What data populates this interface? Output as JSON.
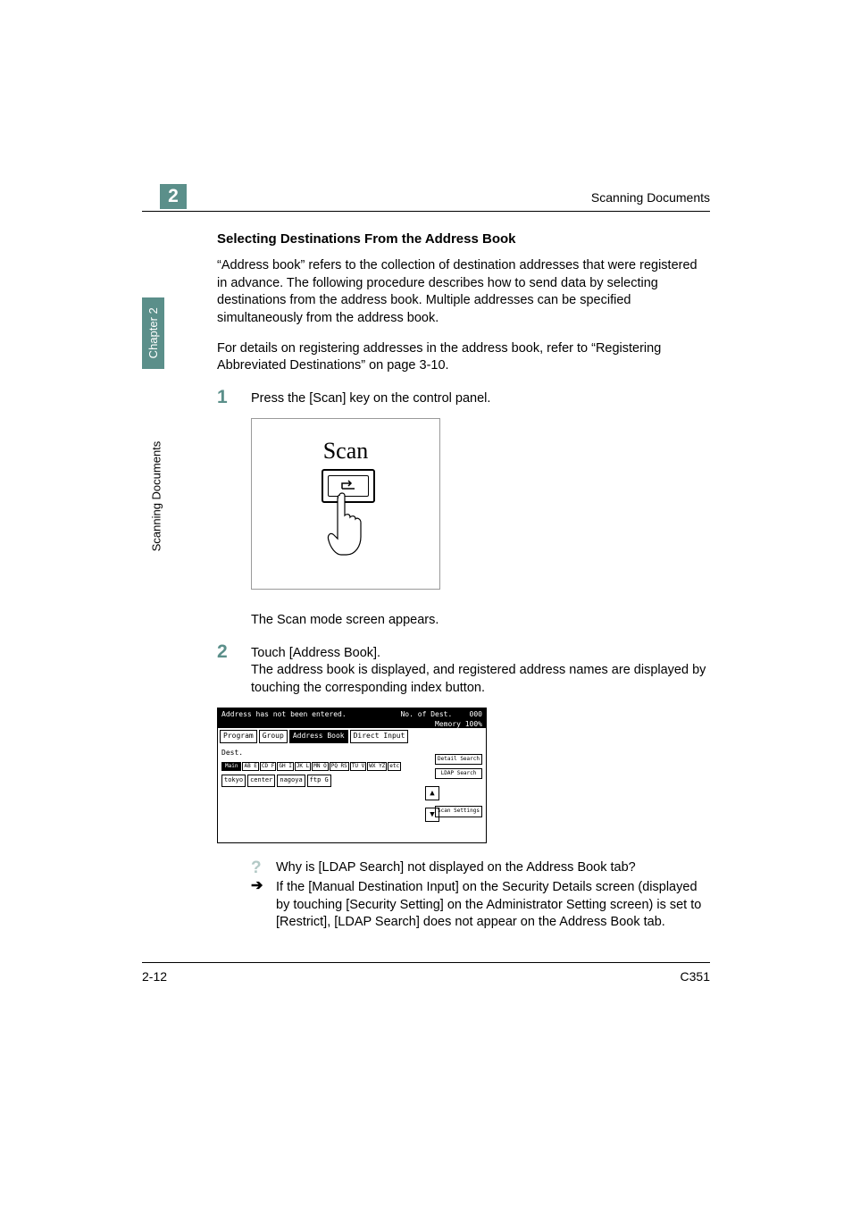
{
  "header": {
    "chapter_number": "2",
    "running_head": "Scanning Documents"
  },
  "side": {
    "tab_chapter": "Chapter 2",
    "tab_section": "Scanning Documents"
  },
  "section": {
    "heading": "Selecting Destinations From the Address Book",
    "para1": "“Address book” refers to the collection of destination addresses that were registered in advance. The following procedure describes how to send data by selecting destinations from the address book. Multiple addresses can be specified simultaneously from the address book.",
    "para2": "For details on registering addresses in the address book, refer to “Registering Abbreviated Destinations” on page 3-10."
  },
  "steps": {
    "s1": {
      "num": "1",
      "text": "Press the [Scan] key on the control panel."
    },
    "after1": "The Scan mode screen appears.",
    "s2": {
      "num": "2",
      "line1": "Touch [Address Book].",
      "line2": "The address book is displayed, and registered address names are displayed by touching the corresponding index button."
    }
  },
  "illus": {
    "scan_label": "Scan",
    "scan_icon": "↵"
  },
  "screenshot": {
    "status": "Address has not been entered.",
    "dest_count_label": "No. of\nDest.",
    "dest_count": "000",
    "memory": "Memory 100%",
    "tabs": {
      "program": "Program",
      "group": "Group",
      "addrbook": "Address\nBook",
      "direct": "Direct\nInput"
    },
    "dest_label": "Dest.",
    "index": {
      "main": "Main",
      "ab": "AB\nE",
      "cd": "CD\nF",
      "gh": "GH\nI",
      "jk": "JK\nL",
      "mn": "MN\nO",
      "pq": "PQ\nRS",
      "tu": "TU\nV",
      "wx": "WX\nYZ",
      "etc": "etc"
    },
    "entries": {
      "e1": "tokyo",
      "e2": "center",
      "e3": "nagoya",
      "e4": "ftp G"
    },
    "side": {
      "detail": "Detail\nSearch",
      "ldap": "LDAP\nSearch",
      "scanset": "Scan\nSettings"
    },
    "arrows": {
      "up": "▲",
      "down": "▼"
    }
  },
  "qa": {
    "q_icon": "?",
    "a_icon": "➔",
    "q": "Why is [LDAP Search] not displayed on the Address Book tab?",
    "a": "If the [Manual Destination Input] on the Security Details screen (displayed by touching [Security Setting] on the Administrator Setting screen) is set to [Restrict], [LDAP Search] does not appear on the Address Book tab."
  },
  "footer": {
    "left": "2-12",
    "right": "C351"
  }
}
